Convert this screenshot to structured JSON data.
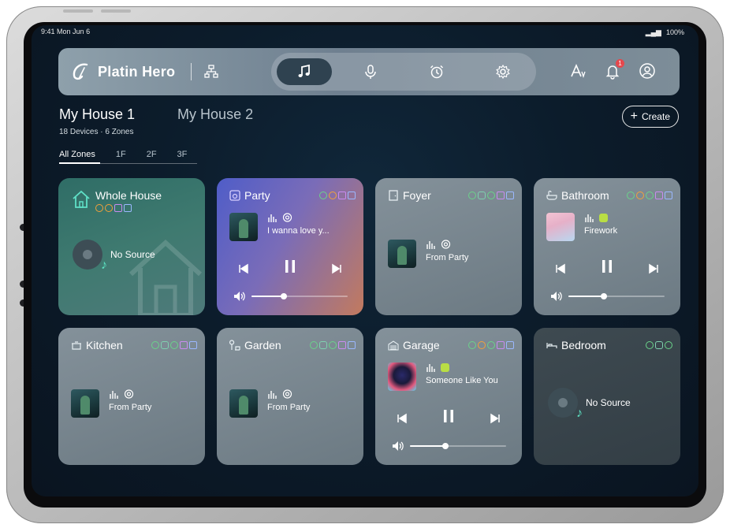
{
  "status_bar": {
    "time": "9:41",
    "date": "Mon Jun 6",
    "battery": "100%"
  },
  "app": {
    "name": "Platin Hero"
  },
  "nav_tabs": [
    {
      "id": "music",
      "icon": "music-note-icon",
      "active": true
    },
    {
      "id": "voice",
      "icon": "microphone-icon",
      "active": false
    },
    {
      "id": "alarm",
      "icon": "alarm-clock-icon",
      "active": false
    },
    {
      "id": "settings",
      "icon": "gear-icon",
      "active": false
    }
  ],
  "header_actions": {
    "notification_badge": "1"
  },
  "houses": {
    "active": "My House 1",
    "inactive": "My House 2",
    "summary": "18 Devices · 6 Zones"
  },
  "create_label": "Create",
  "zone_tabs": [
    "All Zones",
    "1F",
    "2F",
    "3F"
  ],
  "cards": {
    "whole_house": {
      "name": "Whole House",
      "status": "No Source"
    },
    "party": {
      "name": "Party",
      "track": "I wanna love y...",
      "volume": 0.34
    },
    "foyer": {
      "name": "Foyer",
      "status": "From Party"
    },
    "bathroom": {
      "name": "Bathroom",
      "track": "Firework",
      "volume": 0.37
    },
    "kitchen": {
      "name": "Kitchen",
      "status": "From Party"
    },
    "garden": {
      "name": "Garden",
      "status": "From Party"
    },
    "garage": {
      "name": "Garage",
      "track": "Someone Like You",
      "volume": 0.37
    },
    "bedroom": {
      "name": "Bedroom",
      "status": "No Source"
    }
  },
  "colors": {
    "accent": "#2f4250",
    "party_gradient_start": "#5c63c9",
    "party_gradient_end": "#c97a5a",
    "whole_house": "#2f6a63",
    "bedroom": "#3d484f"
  }
}
